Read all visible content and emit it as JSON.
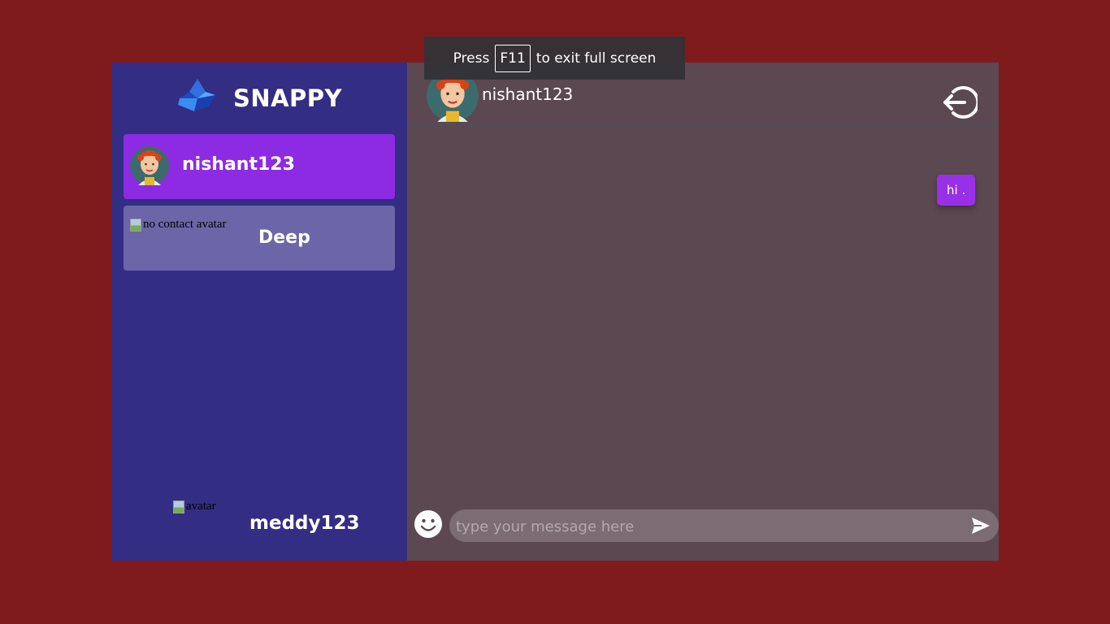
{
  "toast": {
    "before": "Press",
    "key": "F11",
    "after": "to exit full screen"
  },
  "brand": {
    "title": "SNAPPY",
    "logo_icon": "snappy-logo-icon"
  },
  "contacts": [
    {
      "name": "nishant123",
      "avatar": "red-haired-girl-avatar",
      "selected": true
    },
    {
      "name": "Deep",
      "avatar_alt": "no contact avatar",
      "selected": false
    }
  ],
  "current_user": {
    "name": "meddy123",
    "avatar_alt": "avatar"
  },
  "chat": {
    "header_name": "nishant123",
    "logout_icon": "logout-icon",
    "messages": [
      {
        "text": "hi .",
        "direction": "sent"
      }
    ],
    "input": {
      "placeholder": "type your message here",
      "value": ""
    },
    "emoji_icon": "smiley-icon",
    "send_icon": "send-icon"
  },
  "colors": {
    "page_bg": "#801b1d",
    "sidebar_bg": "#332d83",
    "selected_contact": "#8c2be3",
    "contact_bg": "#6a66a8",
    "chat_bg": "#5c4850",
    "sent_bubble": "#9a2fe8"
  }
}
